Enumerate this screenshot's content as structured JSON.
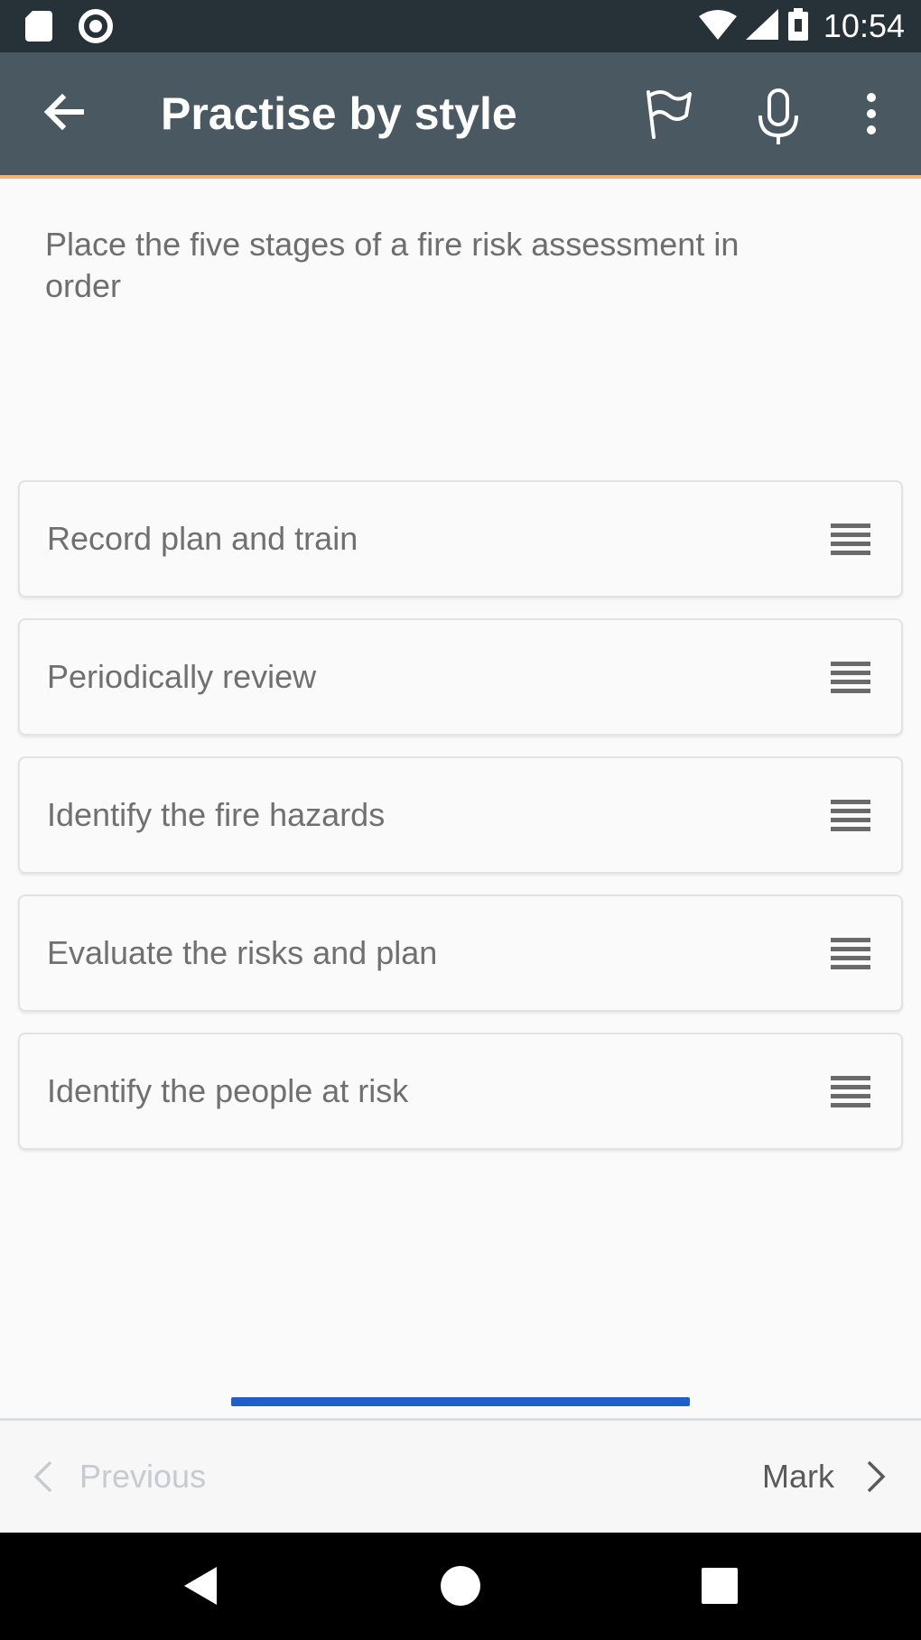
{
  "status_bar": {
    "time": "10:54",
    "icons": [
      "sd-card-icon",
      "sync-circle-icon",
      "wifi-icon",
      "cellular-signal-icon",
      "battery-icon"
    ]
  },
  "app_bar": {
    "title": "Practise by style",
    "icons": [
      "back-arrow-icon",
      "flag-icon",
      "microphone-icon",
      "more-vertical-icon"
    ]
  },
  "question": {
    "text": "Place the five stages of a fire risk assessment in order"
  },
  "items": [
    {
      "label": "Record plan and train"
    },
    {
      "label": "Periodically review"
    },
    {
      "label": "Identify the fire hazards"
    },
    {
      "label": "Evaluate the risks and plan"
    },
    {
      "label": "Identify the people at risk"
    }
  ],
  "bottom_nav": {
    "previous_label": "Previous",
    "mark_label": "Mark"
  },
  "colors": {
    "status_bar": "#263238",
    "app_bar": "#4a5862",
    "app_bar_accent": "#f3b27a",
    "progress": "#1f5fc8",
    "background": "#fafafa"
  }
}
